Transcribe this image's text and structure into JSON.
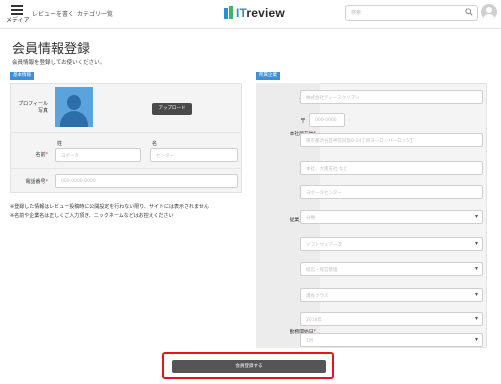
{
  "header": {
    "menu_label": "メディア",
    "nav_review": "レビューを書く",
    "nav_category": "カテゴリ一覧",
    "logo_prefix": "IT",
    "logo_suffix": "review",
    "search_placeholder": "検索"
  },
  "page": {
    "title": "会員情報登録",
    "subtitle": "会員情報を登録してお使いください。"
  },
  "basic": {
    "section_label": "基本情報",
    "profile_label_1": "プロフィール",
    "profile_label_2": "写真",
    "upload_button": "アップロード",
    "name_label": "名前",
    "last_name_label": "姓",
    "first_name_label": "名",
    "last_name_value": "ヨボータ",
    "first_name_value": "センター",
    "phone_label": "電話番号",
    "phone_value": "000-0000-0000",
    "note_1": "※登録した情報はレビュー投稿時に公開設定を行わない限り、サイトには表示されません",
    "note_2": "※名前や企業名は正しくご入力頂き、ニックネームなどはお控えください"
  },
  "company": {
    "section_label": "所属企業",
    "fields": [
      {
        "label": "企業名",
        "required": true,
        "value": "株式会社ディースクリブシ",
        "select": false
      },
      {
        "label": "本社所在地",
        "required": true,
        "zip_prefix": "〒",
        "zip_value": "000-0000",
        "value": "東京都渋谷区神宮前仮6-24丁目ヨーロンバーロン5丁",
        "select": false
      },
      {
        "label": "拠点名",
        "required": false,
        "value": "本社、大阪支社 など",
        "select": false
      },
      {
        "label": "部課名",
        "required": false,
        "value": "ヨボータセンター",
        "select": false
      },
      {
        "label": "従業員規模",
        "required": true,
        "value": "分類",
        "select": true
      },
      {
        "label": "業種",
        "required": true,
        "value": "ソフトウェア一次",
        "select": true
      },
      {
        "label": "職種",
        "required": true,
        "value": "経営・経営管理",
        "select": true
      },
      {
        "label": "役職",
        "required": true,
        "value": "課長クラス",
        "select": true
      },
      {
        "label": "勤務開始日",
        "required": true,
        "value": "2018年",
        "select": true,
        "value_2": "1月"
      }
    ]
  },
  "submit": {
    "label": "会員登録する"
  },
  "colors": {
    "accent_blue": "#3d8fd8",
    "highlight_red": "#e01818",
    "button_dark": "#555555"
  }
}
